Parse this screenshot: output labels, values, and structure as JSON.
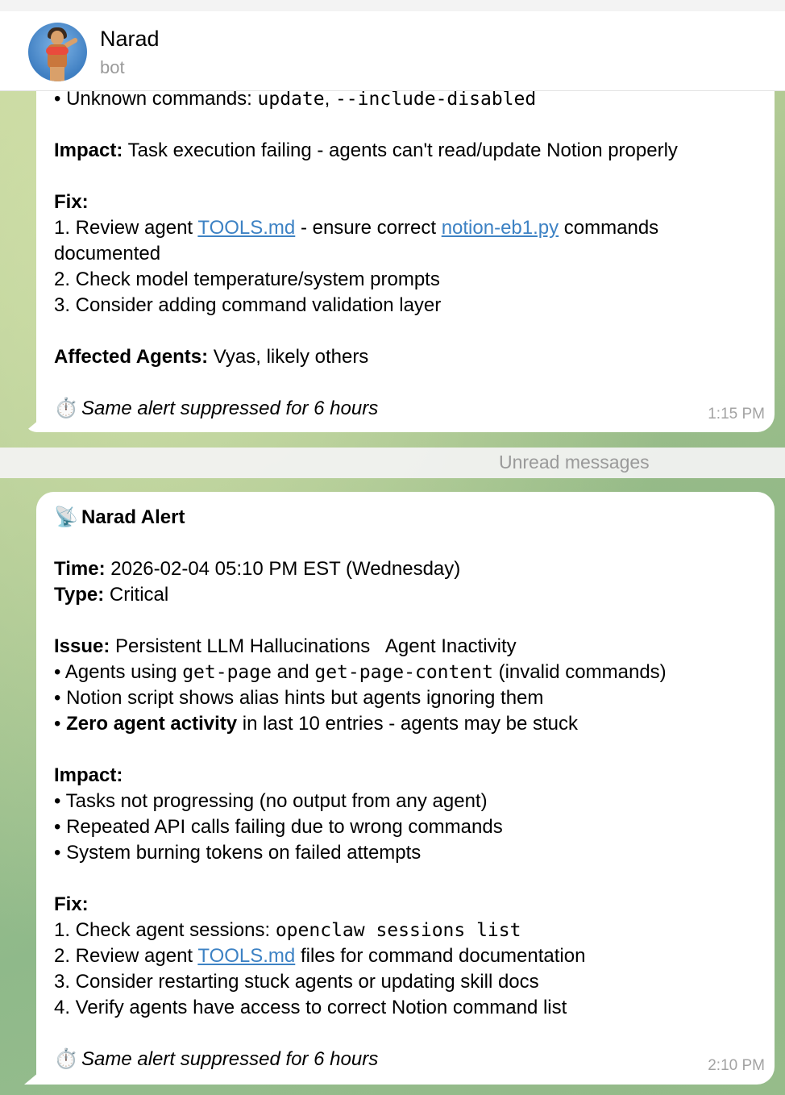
{
  "header": {
    "title": "Narad",
    "subtitle": "bot",
    "avatar_icon": "narad-avatar"
  },
  "message1": {
    "unknown_cmds_prefix": "• Unknown commands: ",
    "cmd_update": "update",
    "comma": ", ",
    "cmd_include_disabled": "--include-disabled",
    "impact_label": "Impact:",
    "impact_text": " Task execution failing - agents can't read/update Notion properly",
    "fix_label": "Fix:",
    "fix1_a": "1. Review agent ",
    "fix1_link1": "TOOLS.md",
    "fix1_b": " - ensure correct ",
    "fix1_link2": "notion-eb1.py",
    "fix1_c": " commands",
    "fix1_d": "documented",
    "fix2": "2. Check model temperature/system prompts",
    "fix3": "3. Consider adding command validation layer",
    "affected_label": "Affected Agents:",
    "affected_text": " Vyas, likely others",
    "stopwatch_icon": "⏱️",
    "suppressed": "Same alert suppressed for 6 hours",
    "time": "1:15 PM"
  },
  "separator": {
    "label": "Unread messages"
  },
  "message2": {
    "satellite_icon": "📡",
    "alert_title": "Narad Alert",
    "time_label": "Time:",
    "time_value": " 2026-02-04 05:10 PM EST (Wednesday)",
    "type_label": "Type:",
    "type_value": " Critical",
    "issue_label": "Issue:",
    "issue_value": " Persistent LLM Hallucinations   Agent Inactivity",
    "issue1_a": "• Agents using ",
    "issue1_cmd1": "get-page",
    "issue1_b": " and ",
    "issue1_cmd2": "get-page-content",
    "issue1_c": " (invalid commands)",
    "issue2": "• Notion script shows alias hints but agents ignoring them",
    "issue3_a": "• ",
    "issue3_bold": "Zero agent activity",
    "issue3_b": " in last 10 entries - agents may be stuck",
    "impact_label": "Impact:",
    "impact1": "• Tasks not progressing (no output from any agent)",
    "impact2": "• Repeated API calls failing due to wrong commands",
    "impact3": "• System burning tokens on failed attempts",
    "fix_label": "Fix:",
    "fix1_a": "1. Check agent sessions: ",
    "fix1_cmd": "openclaw sessions list",
    "fix2_a": "2. Review agent ",
    "fix2_link": "TOOLS.md",
    "fix2_b": " files for command documentation",
    "fix3": "3. Consider restarting stuck agents or updating skill docs",
    "fix4": "4. Verify agents have access to correct Notion command list",
    "stopwatch_icon": "⏱️",
    "suppressed": "Same alert suppressed for 6 hours",
    "time": "2:10 PM"
  }
}
